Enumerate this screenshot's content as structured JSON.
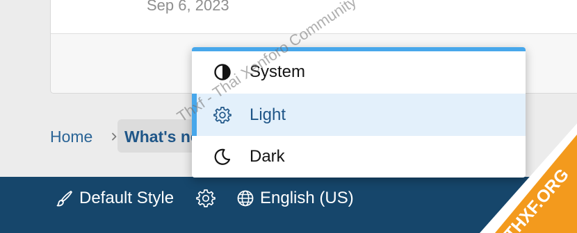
{
  "card": {
    "date": "Sep 6, 2023"
  },
  "breadcrumb": {
    "home": "Home",
    "current": "What's new"
  },
  "footer": {
    "style_label": "Default Style",
    "language_label": "English (US)"
  },
  "theme_menu": {
    "items": [
      {
        "label": "System",
        "icon": "half-circle-icon",
        "selected": false
      },
      {
        "label": "Light",
        "icon": "gear-icon",
        "selected": true
      },
      {
        "label": "Dark",
        "icon": "moon-icon",
        "selected": false
      }
    ],
    "accent_color": "#47a7eb",
    "selected_background": "#e3f0fb"
  },
  "watermark": {
    "text": "Thxf - Thai Xenforo Community"
  },
  "badge": {
    "text": "THXF.ORG",
    "color": "#f39a1d"
  },
  "colors": {
    "footer_background": "#16466b",
    "link": "#2a6496"
  }
}
